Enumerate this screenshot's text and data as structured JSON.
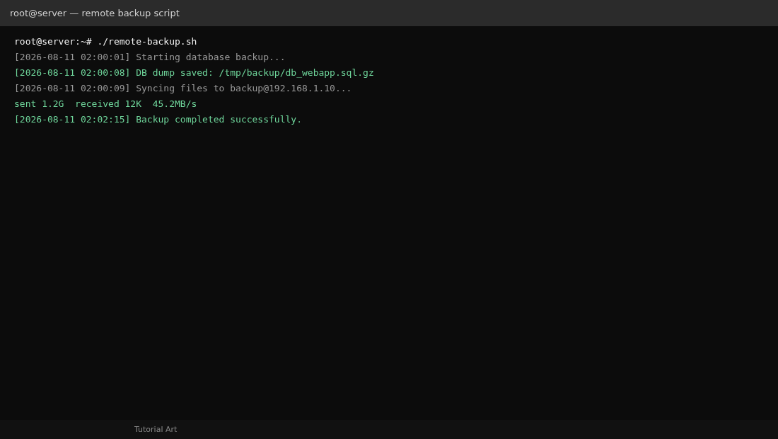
{
  "window": {
    "title": "root@server — remote backup script"
  },
  "terminal": {
    "lines": [
      {
        "kind": "command",
        "text": "root@server:~# ./remote-backup.sh"
      },
      {
        "kind": "info",
        "text": "[2026-08-11 02:00:01] Starting database backup..."
      },
      {
        "kind": "success",
        "text": "[2026-08-11 02:00:08] DB dump saved: /tmp/backup/db_webapp.sql.gz"
      },
      {
        "kind": "info",
        "text": "[2026-08-11 02:00:09] Syncing files to backup@192.168.1.10..."
      },
      {
        "kind": "success",
        "text": "sent 1.2G  received 12K  45.2MB/s"
      },
      {
        "kind": "success",
        "text": "[2026-08-11 02:02:15] Backup completed successfully."
      }
    ]
  },
  "status_bar": {
    "text": "Tutorial Art"
  }
}
